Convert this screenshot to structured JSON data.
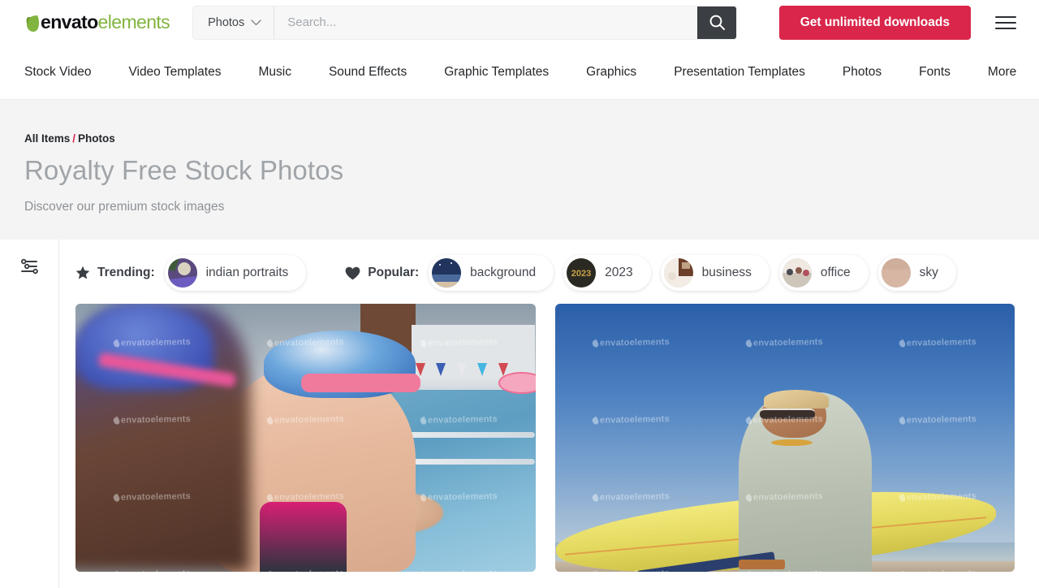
{
  "brand": {
    "logo_primary": "envato",
    "logo_secondary": "elements",
    "accent_red": "#d9264a",
    "accent_green": "#82b440",
    "dark": "#23262a"
  },
  "header": {
    "search": {
      "category": "Photos",
      "placeholder": "Search...",
      "value": "",
      "category_chevron": "chevron-down-icon",
      "submit_icon": "search-icon"
    },
    "cta_label": "Get unlimited downloads",
    "menu_icon": "hamburger-menu-icon"
  },
  "nav": {
    "items": [
      {
        "label": "Stock Video"
      },
      {
        "label": "Video Templates"
      },
      {
        "label": "Music"
      },
      {
        "label": "Sound Effects"
      },
      {
        "label": "Graphic Templates"
      },
      {
        "label": "Graphics"
      },
      {
        "label": "Presentation Templates"
      },
      {
        "label": "Photos"
      },
      {
        "label": "Fonts"
      },
      {
        "label": "More"
      }
    ]
  },
  "hero": {
    "breadcrumb": {
      "root": "All Items",
      "separator": "/",
      "current": "Photos"
    },
    "title": "Royalty Free Stock Photos",
    "subtitle": "Discover our premium stock images"
  },
  "sidebar": {
    "filter_icon": "filters-sliders-icon"
  },
  "pills": {
    "trending": {
      "icon": "star-icon",
      "label": "Trending:",
      "items": [
        {
          "label": "indian portraits",
          "thumb": "indian-portraits-thumb"
        }
      ]
    },
    "popular": {
      "icon": "heart-icon",
      "label": "Popular:",
      "items": [
        {
          "label": "background",
          "thumb": "background-thumb"
        },
        {
          "label": "2023",
          "thumb": "2023-thumb"
        },
        {
          "label": "business",
          "thumb": "business-thumb"
        },
        {
          "label": "office",
          "thumb": "office-thumb"
        },
        {
          "label": "sky",
          "thumb": "sky-thumb"
        }
      ]
    }
  },
  "results": {
    "watermark_text": "envatoelements",
    "items": [
      {
        "alt": "Children in swim caps sitting at the edge of an indoor swimming pool"
      },
      {
        "alt": "Woman in sunglasses holding a yellow surfboard on the beach"
      }
    ]
  }
}
